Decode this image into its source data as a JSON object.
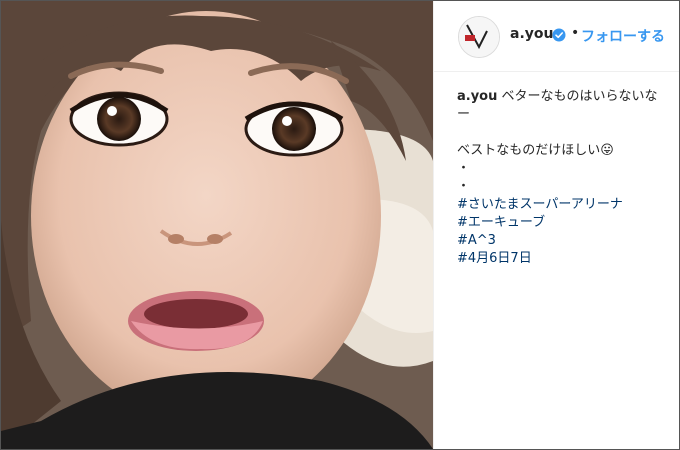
{
  "post": {
    "photo": {
      "description": "selfie"
    },
    "author": {
      "username": "a.you",
      "verified": true
    },
    "follow_label": "フォローする",
    "separator": "•",
    "caption": {
      "username": "a.you",
      "line1": "ベターなものはいらないなー",
      "line2": "ベストなものだけほしい",
      "line2_emoji": "😛",
      "dot1": "・",
      "dot2": "・",
      "hashtags": [
        "#さいたまスーパーアリーナ",
        "#エーキューブ",
        "#A^3",
        "#4月6日7日"
      ]
    },
    "colors": {
      "link": "#003569",
      "follow": "#3897f0",
      "verified": "#3897f0"
    }
  }
}
